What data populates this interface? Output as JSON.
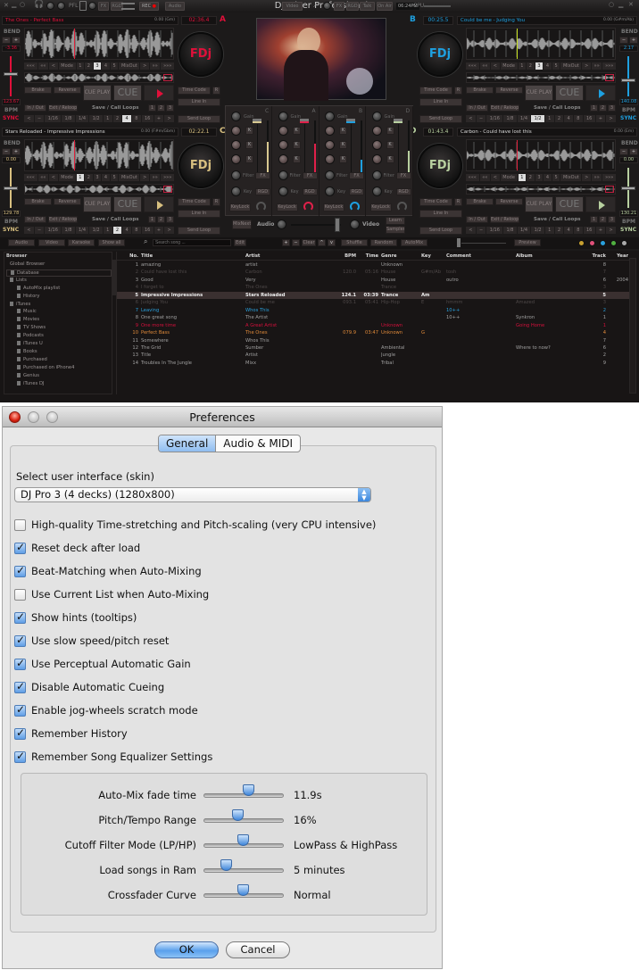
{
  "app": {
    "title": "DJ Mixer Professional",
    "topbar": {
      "pfl": "PFL",
      "fx": "FX",
      "rgd": "RGD",
      "rec": "REC",
      "audio": "Audio",
      "video": "Video",
      "fx2": "FX",
      "rgd2": "RGD",
      "talk": "Talk",
      "on_air": "On Air",
      "clock": "06:24PM",
      "cpu": "CPU"
    }
  },
  "deck_labels": {
    "bend": "BEND",
    "bpm": "BPM",
    "sync": "SYNC",
    "minus": "−",
    "plus": "+",
    "transport": [
      "«««",
      "««",
      "<",
      "Mode",
      "1",
      "2",
      "3",
      "4",
      "5",
      "MixOut",
      ">",
      "»»",
      "»»»"
    ],
    "brake": "Brake",
    "reverse": "Reverse",
    "cue_play": "CUE PLAY",
    "cue": "CUE",
    "in_out": "In / Out",
    "exit_reloop": "Exit / Reloop",
    "save_call_loops": "Save / Call Loops",
    "loop_slots": [
      "1",
      "2",
      "3"
    ],
    "loop_row": [
      "<",
      "−",
      "1/16",
      "1/8",
      "1/4",
      "1/2",
      "1",
      "2",
      "4",
      "8",
      "16",
      "+",
      ">"
    ],
    "time_code": "Time Code",
    "r": "R",
    "line_in": "Line In",
    "send_loop": "Send Loop"
  },
  "decks": [
    {
      "letter": "A",
      "title": "The Ones - Perfect Bass",
      "key": "0.00 (Gm)",
      "time": "02:36.4",
      "bend_value": "-3.36",
      "bpm": "123.67",
      "logo": "FDj",
      "color": "#e0103a",
      "title_color": "#e0103a",
      "hot_active": 6,
      "loop_active": 8,
      "pitch": 0.45,
      "side": "left"
    },
    {
      "letter": "B",
      "title": "Could be me - Judging You",
      "key": "0.00 (G#m/Ab)",
      "time": "00:25.5",
      "bend_value": "2.17",
      "bpm": "140.08",
      "logo": "FDj",
      "color": "#1ea0e0",
      "title_color": "#1ea0e0",
      "hot_active": 6,
      "loop_active": 5,
      "pitch": 0.62,
      "side": "right"
    },
    {
      "letter": "C",
      "title": "Stars Reloaded - Impressive Impressions",
      "key": "0.00 (F#m/Gbm)",
      "time": "02:22.1",
      "bend_value": "0.00",
      "bpm": "129.78",
      "logo": "FDj",
      "color": "#d8c080",
      "title_color": "#dddddd",
      "hot_active": 4,
      "loop_active": 7,
      "pitch": 0.5,
      "side": "left"
    },
    {
      "letter": "D",
      "title": "Carbon - Could have lost this",
      "key": "0.00 (Em)",
      "time": "01:43.4",
      "bend_value": "0.00",
      "bpm": "130.21",
      "logo": "FDj",
      "color": "#b8d0a0",
      "title_color": "#dddddd",
      "hot_active": 4,
      "loop_active": -1,
      "pitch": 0.5,
      "side": "right"
    }
  ],
  "mixer": {
    "labels": {
      "gain": "Gain",
      "k": "K",
      "filter": "Filter",
      "key": "Key",
      "fx": "FX",
      "rgd": "RGD",
      "keylock": "KeyLock"
    },
    "strips": [
      {
        "letter": "C",
        "color": "#d8c890"
      },
      {
        "letter": "A",
        "color": "#e0204a"
      },
      {
        "letter": "B",
        "color": "#1ea0e0"
      },
      {
        "letter": "D",
        "color": "#b8d0a0"
      }
    ],
    "mix_next": "MixNext",
    "audio": "Audio",
    "video": "Video",
    "learn": "Learn",
    "sampler": "Sampler",
    "crossfader": 0.95
  },
  "toolbar": {
    "audio": "Audio",
    "video": "Video",
    "karaoke": "Karaoke",
    "show_all": "Show all",
    "search_placeholder": "Search song ...",
    "edit": "Edit",
    "plus": "+",
    "minus": "−",
    "clear": "Clear",
    "up": "^",
    "down": "v",
    "shuffle": "Shuffle",
    "random": "Random",
    "automix": "AutoMix",
    "preview": "Preview",
    "dots": [
      "#c8a030",
      "#e0507a",
      "#2aa0dc",
      "#50b040",
      "#aaaaaa"
    ]
  },
  "browser": {
    "header": "Browser",
    "items": [
      {
        "label": "Global Browser",
        "indent": 1,
        "icon": "none"
      },
      {
        "label": "Database",
        "indent": 1,
        "icon": "database-icon"
      },
      {
        "label": "Lists",
        "indent": 1,
        "icon": "list-icon"
      },
      {
        "label": "AutoMix playlist",
        "indent": 2,
        "icon": "playlist-icon"
      },
      {
        "label": "History",
        "indent": 2,
        "icon": "playlist-icon"
      },
      {
        "label": "iTunes",
        "indent": 1,
        "icon": "music-note-icon"
      },
      {
        "label": "Music",
        "indent": 2,
        "icon": "playlist-icon"
      },
      {
        "label": "Movies",
        "indent": 2,
        "icon": "playlist-icon"
      },
      {
        "label": "TV Shows",
        "indent": 2,
        "icon": "playlist-icon"
      },
      {
        "label": "Podcasts",
        "indent": 2,
        "icon": "playlist-icon"
      },
      {
        "label": "iTunes U",
        "indent": 2,
        "icon": "playlist-icon"
      },
      {
        "label": "Books",
        "indent": 2,
        "icon": "playlist-icon"
      },
      {
        "label": "Purchased",
        "indent": 2,
        "icon": "playlist-icon"
      },
      {
        "label": "Purchased on iPhone4",
        "indent": 2,
        "icon": "playlist-icon"
      },
      {
        "label": "Genius",
        "indent": 2,
        "icon": "playlist-icon"
      },
      {
        "label": "iTunes DJ",
        "indent": 2,
        "icon": "playlist-icon"
      }
    ]
  },
  "table": {
    "columns": [
      "No.",
      "Title",
      "Artist",
      "BPM",
      "Time",
      "Genre",
      "Key",
      "Comment",
      "Album",
      "Track",
      "Year"
    ],
    "rows": [
      {
        "style": "",
        "cells": [
          "1",
          "amazing",
          "artist",
          "",
          "",
          "Unknown",
          "",
          "",
          "",
          "8",
          ""
        ]
      },
      {
        "style": "dim",
        "cells": [
          "2",
          "Could have lost this",
          "Carbon",
          "120.0",
          "05:16",
          "House",
          "G#m/Ab",
          "tosh",
          "",
          "7",
          ""
        ]
      },
      {
        "style": "",
        "cells": [
          "3",
          "Good",
          "Very",
          "",
          "",
          "House",
          "",
          "outro",
          "",
          "6",
          "2004"
        ]
      },
      {
        "style": "dim",
        "cells": [
          "4",
          "I forget to",
          "The Ones",
          "",
          "",
          "Trance",
          "",
          "",
          "",
          "3",
          ""
        ]
      },
      {
        "style": "sel",
        "cells": [
          "5",
          "Impressive Impressions",
          "Stars Reloaded",
          "124.1",
          "03:39",
          "Trance",
          "Am",
          "",
          "",
          "5",
          ""
        ]
      },
      {
        "style": "dim",
        "cells": [
          "6",
          "Judging You",
          "Could be me",
          "093.1",
          "05:41",
          "Hip-Hop",
          "E",
          "hmmm",
          "Amazed",
          "3",
          ""
        ]
      },
      {
        "style": "blue",
        "cells": [
          "7",
          "Leaving",
          "Whos This",
          "",
          "",
          "",
          "",
          "10++",
          "",
          "2",
          ""
        ]
      },
      {
        "style": "",
        "cells": [
          "8",
          "One great song",
          "The Artist",
          "",
          "",
          "",
          "",
          "10++",
          "Synkron",
          "1",
          ""
        ]
      },
      {
        "style": "red",
        "cells": [
          "9",
          "One more time",
          "A Great Artist",
          "",
          "",
          "Unknown",
          "",
          "",
          "Going Home",
          "1",
          ""
        ]
      },
      {
        "style": "orange",
        "cells": [
          "10",
          "Perfect Bass",
          "The Ones",
          "079.9",
          "03:47",
          "Unknown",
          "G",
          "",
          "",
          "4",
          ""
        ]
      },
      {
        "style": "",
        "cells": [
          "11",
          "Somewhere",
          "Whos This",
          "",
          "",
          "",
          "",
          "",
          "",
          "7",
          ""
        ]
      },
      {
        "style": "",
        "cells": [
          "12",
          "The Grid",
          "Sumber",
          "",
          "",
          "Ambiental",
          "",
          "",
          "Where to now?",
          "6",
          ""
        ]
      },
      {
        "style": "",
        "cells": [
          "13",
          "Title",
          "Artist",
          "",
          "",
          "Jungle",
          "",
          "",
          "",
          "2",
          ""
        ]
      },
      {
        "style": "",
        "cells": [
          "14",
          "Troubles In The Jungle",
          "Mixx",
          "",
          "",
          "Tribal",
          "",
          "",
          "",
          "9",
          ""
        ]
      }
    ]
  },
  "preferences": {
    "title": "Preferences",
    "tabs": [
      "General",
      "Audio & MIDI"
    ],
    "skin_label": "Select user interface (skin)",
    "skin_value": "DJ Pro 3 (4 decks) (1280x800)",
    "options": [
      {
        "label": "High-quality Time-stretching and Pitch-scaling (very CPU intensive)",
        "checked": false
      },
      {
        "label": "Reset deck after load",
        "checked": true
      },
      {
        "label": "Beat-Matching when Auto-Mixing",
        "checked": true
      },
      {
        "label": "Use Current List when Auto-Mixing",
        "checked": false
      },
      {
        "label": "Show hints (tooltips)",
        "checked": true
      },
      {
        "label": "Use slow speed/pitch reset",
        "checked": true
      },
      {
        "label": "Use Perceptual Automatic Gain",
        "checked": true
      },
      {
        "label": "Disable Automatic Cueing",
        "checked": true
      },
      {
        "label": "Enable jog-wheels scratch mode",
        "checked": true
      },
      {
        "label": "Remember History",
        "checked": true
      },
      {
        "label": "Remember Song Equalizer Settings",
        "checked": true
      }
    ],
    "sliders": [
      {
        "label": "Auto-Mix fade time",
        "value": "11.9s",
        "position": 0.56
      },
      {
        "label": "Pitch/Tempo Range",
        "value": "16%",
        "position": 0.42
      },
      {
        "label": "Cutoff Filter Mode (LP/HP)",
        "value": "LowPass & HighPass",
        "position": 0.49
      },
      {
        "label": "Load songs in Ram",
        "value": "5 minutes",
        "position": 0.28
      },
      {
        "label": "Crossfader Curve",
        "value": "Normal",
        "position": 0.49
      }
    ],
    "ok": "OK",
    "cancel": "Cancel"
  }
}
